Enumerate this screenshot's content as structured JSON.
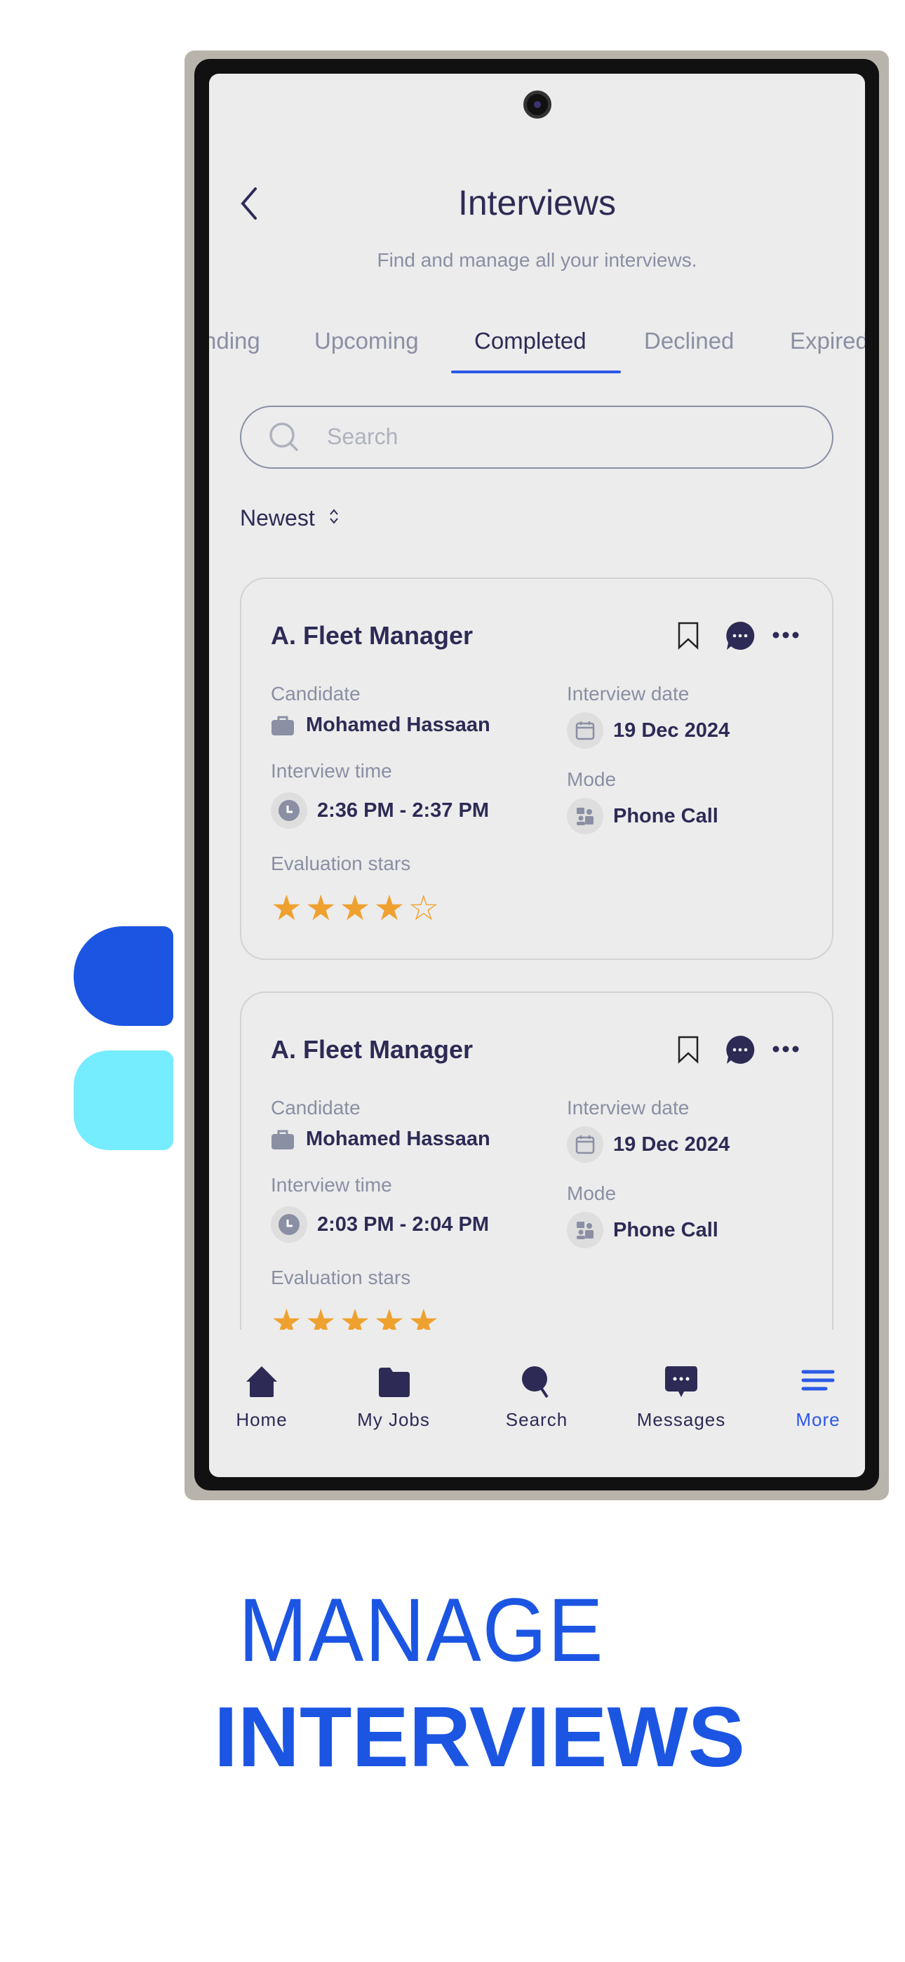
{
  "header": {
    "title": "Interviews",
    "subtitle": "Find and manage all your interviews."
  },
  "tabs": [
    {
      "label": "nding"
    },
    {
      "label": "Upcoming"
    },
    {
      "label": "Completed",
      "active": true
    },
    {
      "label": "Declined"
    },
    {
      "label": "Expired"
    }
  ],
  "search": {
    "placeholder": "Search"
  },
  "sort": {
    "label": "Newest"
  },
  "cards": [
    {
      "title": "A. Fleet Manager",
      "candidate_label": "Candidate",
      "candidate": "Mohamed Hassaan",
      "date_label": "Interview date",
      "date": "19 Dec 2024",
      "time_label": "Interview time",
      "time": "2:36 PM - 2:37 PM",
      "mode_label": "Mode",
      "mode": "Phone Call",
      "stars_label": "Evaluation stars",
      "stars": 4,
      "max_stars": 5
    },
    {
      "title": "A. Fleet Manager",
      "candidate_label": "Candidate",
      "candidate": "Mohamed Hassaan",
      "date_label": "Interview date",
      "date": "19 Dec 2024",
      "time_label": "Interview time",
      "time": "2:03 PM - 2:04 PM",
      "mode_label": "Mode",
      "mode": "Phone Call",
      "stars_label": "Evaluation stars",
      "stars": 5,
      "max_stars": 5
    }
  ],
  "nav": [
    {
      "label": "Home",
      "icon": "home-icon"
    },
    {
      "label": "My Jobs",
      "icon": "folder-icon"
    },
    {
      "label": "Search",
      "icon": "search-icon"
    },
    {
      "label": "Messages",
      "icon": "message-icon"
    },
    {
      "label": "More",
      "icon": "menu-icon",
      "active": true
    }
  ],
  "promo": {
    "line1": "MANAGE",
    "line2": "INTERVIEWS"
  },
  "colors": {
    "accent": "#1b55e2",
    "navy": "#2d2b55",
    "star": "#efa12f",
    "cyan": "#76ecff"
  }
}
